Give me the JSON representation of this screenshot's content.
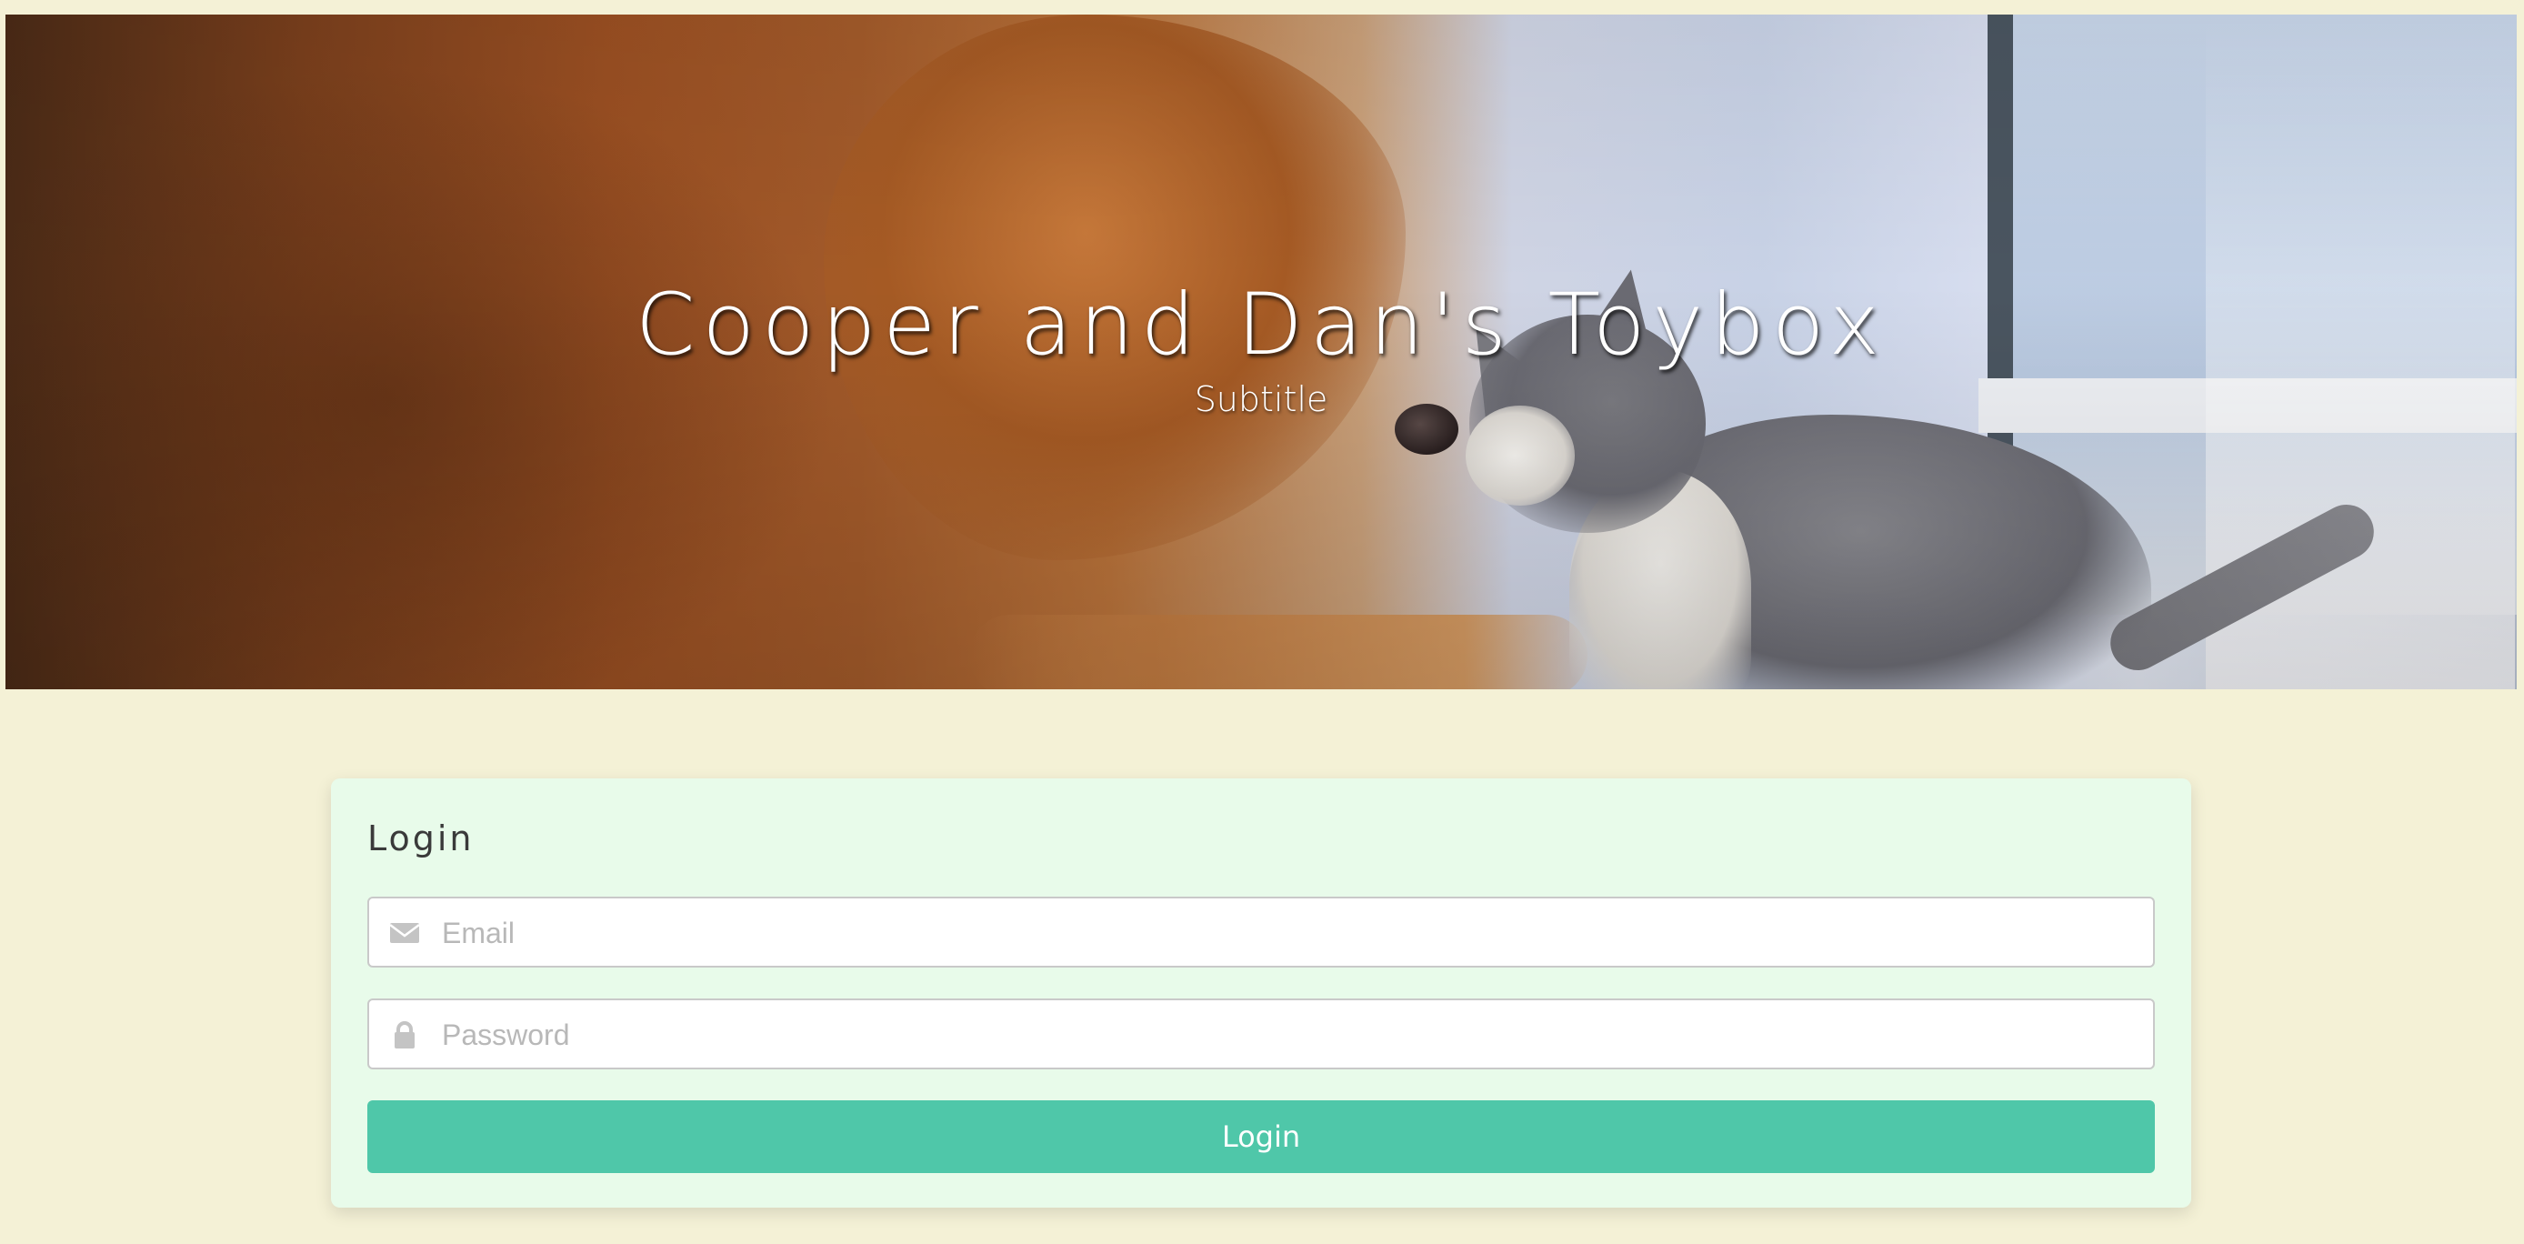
{
  "hero": {
    "title": "Cooper and Dan's Toybox",
    "subtitle": "Subtitle",
    "image_description_icon": "dog-and-kitten-photo"
  },
  "login": {
    "heading": "Login",
    "email": {
      "placeholder": "Email",
      "value": "",
      "icon": "envelope-icon"
    },
    "password": {
      "placeholder": "Password",
      "value": "",
      "icon": "lock-icon"
    },
    "submit_label": "Login"
  },
  "colors": {
    "page_background": "#f4f1d6",
    "card_background": "#e8fbea",
    "button_accent": "#4fc7a9",
    "icon_gray": "#c4c4c4"
  }
}
